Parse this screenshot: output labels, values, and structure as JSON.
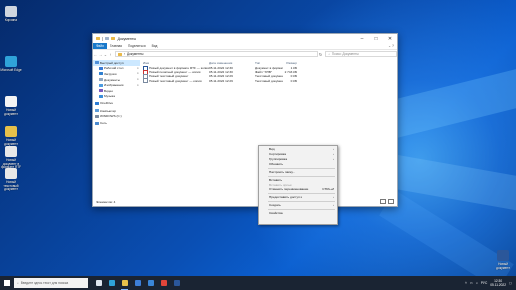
{
  "desktop": {
    "icons": [
      {
        "label": "Корзина",
        "color": "#cfd6df",
        "icon": "recycle-bin-icon"
      },
      {
        "label": "Microsoft Edge",
        "color": "#2fa3d9",
        "icon": "edge-icon"
      },
      {
        "label": "Новый документ",
        "color": "#f4f4f4",
        "icon": "document-icon"
      },
      {
        "label": "Новый документ",
        "color": "#e6c04a",
        "icon": "folder-icon"
      },
      {
        "label": "Новый документ в формате RTF",
        "color": "#e8e8e8",
        "icon": "rtf-file-icon"
      },
      {
        "label": "Новый текстовый документ",
        "color": "#e8e8e8",
        "icon": "text-file-icon"
      }
    ],
    "right_icon": {
      "label": "Новый документ",
      "color": "#2b579a",
      "icon": "word-file-icon"
    }
  },
  "window": {
    "title": "Документы",
    "ribbon_tabs": [
      "Файл",
      "Главная",
      "Поделиться",
      "Вид"
    ],
    "address": "Документы",
    "search_placeholder": "Поиск: Документы",
    "nav": [
      {
        "label": "Быстрый доступ",
        "color": "#4f8fd8",
        "pinned": false,
        "selected": true,
        "icon": "star-icon"
      },
      {
        "label": "Рабочий стол",
        "color": "#3a7bd5",
        "pinned": true,
        "selected": false,
        "icon": "desktop-icon"
      },
      {
        "label": "Загрузки",
        "color": "#2f7fd0",
        "pinned": true,
        "selected": false,
        "icon": "download-icon"
      },
      {
        "label": "Документы",
        "color": "#8fa6c0",
        "pinned": true,
        "selected": false,
        "icon": "documents-icon"
      },
      {
        "label": "Изображения",
        "color": "#4b9be0",
        "pinned": true,
        "selected": false,
        "icon": "pictures-icon"
      },
      {
        "label": "Видео",
        "color": "#7a58c0",
        "pinned": false,
        "selected": false,
        "icon": "video-icon"
      },
      {
        "label": "Музыка",
        "color": "#3b8ed8",
        "pinned": false,
        "selected": false,
        "icon": "music-icon"
      },
      {
        "label": "OneDrive",
        "color": "#2a7bd4",
        "pinned": false,
        "selected": false,
        "icon": "onedrive-icon"
      },
      {
        "label": "Компьютер",
        "color": "#5a9ad8",
        "pinned": false,
        "selected": false,
        "icon": "computer-icon"
      },
      {
        "label": "WINDOWS (C:)",
        "color": "#7a8aa0",
        "pinned": false,
        "selected": false,
        "icon": "drive-icon"
      },
      {
        "label": "Сеть",
        "color": "#4a8ad0",
        "pinned": false,
        "selected": false,
        "icon": "network-icon"
      }
    ],
    "columns": {
      "name": "Имя",
      "date": "Дата изменения",
      "type": "Тип",
      "size": "Размер"
    },
    "files": [
      {
        "name": "Новый документ в формате RTF — копия",
        "date": "05.11.2022 12:30",
        "type": "Документ в формате RTF",
        "size": "1 КБ",
        "kind": "doc"
      },
      {
        "name": "Новый печатный документ — копия",
        "date": "05.11.2022 12:30",
        "type": "Файл \"XHB\"",
        "size": "2 743 КБ",
        "kind": "pdf"
      },
      {
        "name": "Новый текстовый документ",
        "date": "05.11.2022 12:29",
        "type": "Текстовый документ",
        "size": "0 КБ",
        "kind": "txt"
      },
      {
        "name": "Новый текстовый документ — копия",
        "date": "05.11.2022 12:29",
        "type": "Текстовый документ",
        "size": "0 КБ",
        "kind": "txt"
      }
    ],
    "status": "Элементов: 4"
  },
  "context_menu": {
    "items": [
      {
        "label": "Вид",
        "arrow": true,
        "shortcut": "",
        "disabled": false,
        "sep_after": false
      },
      {
        "label": "Сортировка",
        "arrow": true,
        "shortcut": "",
        "disabled": false,
        "sep_after": false
      },
      {
        "label": "Группировка",
        "arrow": true,
        "shortcut": "",
        "disabled": false,
        "sep_after": false
      },
      {
        "label": "Обновить",
        "arrow": false,
        "shortcut": "",
        "disabled": false,
        "sep_after": true
      },
      {
        "label": "Настроить папку...",
        "arrow": false,
        "shortcut": "",
        "disabled": false,
        "sep_after": true
      },
      {
        "label": "Вставить",
        "arrow": false,
        "shortcut": "",
        "disabled": false,
        "sep_after": false
      },
      {
        "label": "Вставить ярлык",
        "arrow": false,
        "shortcut": "",
        "disabled": true,
        "sep_after": false
      },
      {
        "label": "Отменить переименование",
        "arrow": false,
        "shortcut": "CTRL+Z",
        "disabled": false,
        "sep_after": true
      },
      {
        "label": "Предоставить доступ к",
        "arrow": true,
        "shortcut": "",
        "disabled": false,
        "sep_after": true
      },
      {
        "label": "Создать",
        "arrow": true,
        "shortcut": "",
        "disabled": false,
        "sep_after": true
      },
      {
        "label": "Свойства",
        "arrow": false,
        "shortcut": "",
        "disabled": false,
        "sep_after": false
      }
    ]
  },
  "taskbar": {
    "search_placeholder": "Введите здесь текст для поиска",
    "apps": [
      {
        "name": "task-view-icon",
        "color": "#dfe6ef",
        "active": false
      },
      {
        "name": "edge-taskbar-icon",
        "color": "#2fa3d9",
        "active": false
      },
      {
        "name": "explorer-taskbar-icon",
        "color": "#e6c04a",
        "active": true
      },
      {
        "name": "store-taskbar-icon",
        "color": "#3d7fd9",
        "active": false
      },
      {
        "name": "mail-taskbar-icon",
        "color": "#3a86d8",
        "active": false
      },
      {
        "name": "chrome-taskbar-icon",
        "color": "#e0453a",
        "active": false
      },
      {
        "name": "word-taskbar-icon",
        "color": "#2b579a",
        "active": false
      }
    ],
    "language": "РУС",
    "time": "12:30",
    "date": "05.11.2022"
  }
}
